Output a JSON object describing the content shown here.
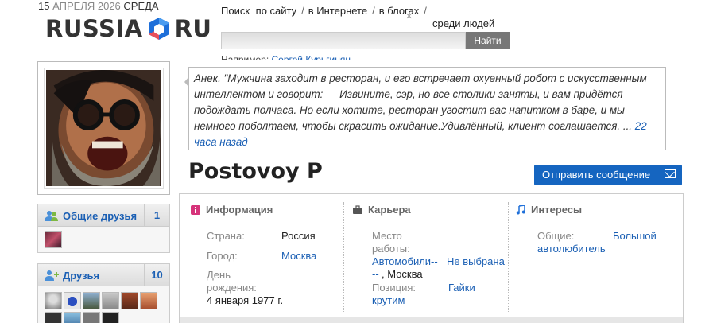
{
  "header": {
    "date_day": "15",
    "date_month_year": "АПРЕЛЯ 2026",
    "date_weekday": "СРЕДА",
    "logo_left": "RUSSIA",
    "logo_right": "RU"
  },
  "search": {
    "label": "Поиск",
    "scope_site": "по сайту",
    "scope_internet": "в Интернете",
    "scope_blogs": "в блогах",
    "scope_people": "среди людей",
    "sep": "/",
    "button": "Найти",
    "example_prefix": "Например:",
    "example_link": "Сергей Курьгинян"
  },
  "status": {
    "text": "Анек. \"Мужчина заходит в ресторан, и его встречает охуенный  робот с искусственным интеллектом и говорит: — Извините, сэр, но все столики заняты, и вам придётся подождать полчаса. Но если хотите, ресторан угостит вас напитком в баре, и мы немного поболтаем, чтобы скрасить ожидание.Удивлённый, клиент соглашается. ...",
    "time_link": "22 часа назад"
  },
  "profile": {
    "name": "Postovoy P",
    "send_message": "Отправить сообщение"
  },
  "info": {
    "title": "Информация",
    "country_label": "Страна:",
    "country_value": "Россия",
    "city_label": "Город:",
    "city_value": "Москва",
    "birthday_label_1": "День",
    "birthday_label_2": "рождения:",
    "birthday_value": "4 января 1977 г."
  },
  "career": {
    "title": "Карьера",
    "place_label_1": "Место",
    "place_label_2": "работы:",
    "company_link": "Автомобили--",
    "city_not_selected": "Не выбрана",
    "dash_link": "--",
    "city_suffix": ", Москва",
    "position_label": "Позиция:",
    "position_value_1": "Гайки",
    "position_value_2": "крутим"
  },
  "interests": {
    "title": "Интересы",
    "general_label": "Общие:",
    "general_value_1": "Большой",
    "general_value_2": "автолюбитель"
  },
  "mutual_friends": {
    "title": "Общие друзья",
    "count": "1"
  },
  "friends": {
    "title": "Друзья",
    "count": "10"
  },
  "colors": {
    "accent_blue": "#1565c0",
    "link_blue": "#1a5fb4",
    "logo_hex_blue": "#1e6fd9",
    "logo_hex_red": "#e8505b"
  }
}
